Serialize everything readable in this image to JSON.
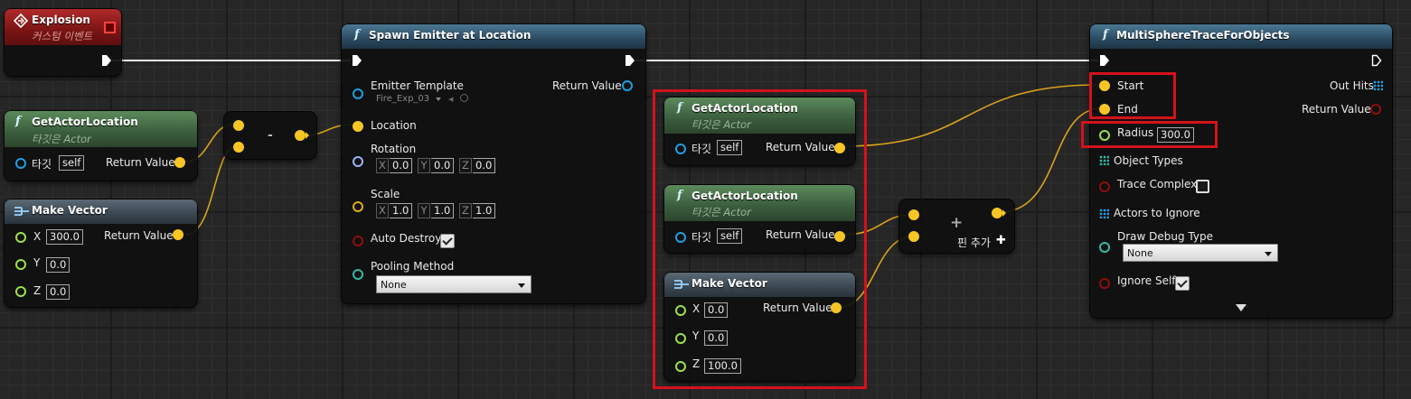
{
  "colors": {
    "exec": "#ffffff",
    "vector": "#f7c524",
    "object": "#1e9ee4",
    "transform": "#7aa3e8",
    "rotator": "#9fb2f5",
    "struct": "#34b9a6",
    "bool": "#8e0e0e",
    "float": "#9de04a",
    "highlight": "#d4121c",
    "wire": "#e0a81c"
  },
  "explosion": {
    "title": "Explosion",
    "subtitle": "커스텀 이벤트"
  },
  "spawn": {
    "title": "Spawn Emitter at Location",
    "emitter_template": "Emitter Template",
    "emitter_value": "Fire_Exp_03",
    "return_value": "Return Value",
    "location": "Location",
    "rotation": "Rotation",
    "rot_x": "0.0",
    "rot_y": "0.0",
    "rot_z": "0.0",
    "scale": "Scale",
    "scale_x": "1.0",
    "scale_y": "1.0",
    "scale_z": "1.0",
    "auto_destroy": "Auto Destroy",
    "pooling": "Pooling Method",
    "pooling_value": "None"
  },
  "gal1": {
    "title": "GetActorLocation",
    "subtitle": "타깃은 Actor",
    "target": "타깃",
    "target_value": "self",
    "return_value": "Return Value"
  },
  "mv1": {
    "title": "Make Vector",
    "x_label": "X",
    "x": "300.0",
    "y_label": "Y",
    "y": "0.0",
    "z_label": "Z",
    "z": "0.0",
    "return_value": "Return Value"
  },
  "minus": {
    "symbol": "-"
  },
  "gal2": {
    "title": "GetActorLocation",
    "subtitle": "타깃은 Actor",
    "target": "타깃",
    "target_value": "self",
    "return_value": "Return Value"
  },
  "gal3": {
    "title": "GetActorLocation",
    "subtitle": "타깃은 Actor",
    "target": "타깃",
    "target_value": "self",
    "return_value": "Return Value"
  },
  "mv2": {
    "title": "Make Vector",
    "x_label": "X",
    "x": "0.0",
    "y_label": "Y",
    "y": "0.0",
    "z_label": "Z",
    "z": "100.0",
    "return_value": "Return Value"
  },
  "plus": {
    "symbol": "+",
    "add_pin": "핀 추가",
    "add_symbol": "✚"
  },
  "trace": {
    "title": "MultiSphereTraceForObjects",
    "start": "Start",
    "end": "End",
    "radius": "Radius",
    "radius_value": "300.0",
    "object_types": "Object Types",
    "trace_complex": "Trace Complex",
    "actors_to_ignore": "Actors to Ignore",
    "draw_debug": "Draw Debug Type",
    "draw_debug_value": "None",
    "ignore_self": "Ignore Self",
    "out_hits": "Out Hits",
    "return_value": "Return Value"
  }
}
